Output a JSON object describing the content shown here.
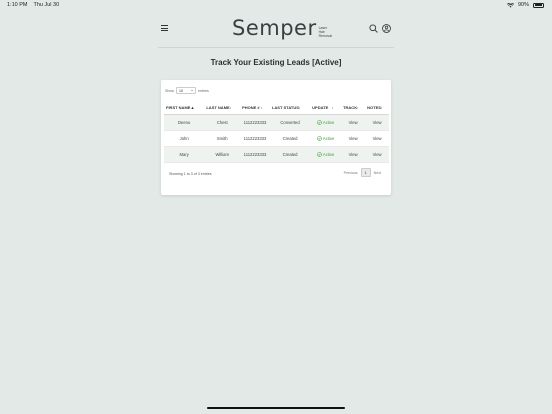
{
  "status_bar": {
    "time": "1:10 PM",
    "date": "Thu Jul 30",
    "battery": "90%"
  },
  "header": {
    "logo_word": "Semper",
    "logo_tag_1": "Laser",
    "logo_tag_2": "Hair",
    "logo_tag_3": "Removal"
  },
  "page": {
    "title": "Track Your Existing Leads [Active]"
  },
  "table_controls": {
    "show_label": "Show",
    "entries_value": "10",
    "entries_label": "entries"
  },
  "table": {
    "columns": [
      "FIRST NAME",
      "LAST NAME",
      "PHONE #",
      "LAST STATUS",
      "UPDATE",
      "TRACK",
      "NOTES"
    ],
    "rows": [
      {
        "first": "Deenu",
        "last": "Chest",
        "phone": "1112223333",
        "status": "Converted",
        "update": "Active",
        "track": "View",
        "notes": "View"
      },
      {
        "first": "John",
        "last": "Smith",
        "phone": "1112223333",
        "status": "Created",
        "update": "Active",
        "track": "View",
        "notes": "View"
      },
      {
        "first": "Mary",
        "last": "William",
        "phone": "1112223333",
        "status": "Created",
        "update": "Active",
        "track": "View",
        "notes": "View"
      }
    ]
  },
  "footer": {
    "info": "Showing 1 to 3 of 3 entries",
    "previous": "Previous",
    "page": "1",
    "next": "Next"
  },
  "colors": {
    "background": "#e3e9e6",
    "active_green": "#3a9a3a",
    "row_stripe": "#eef3f0"
  }
}
